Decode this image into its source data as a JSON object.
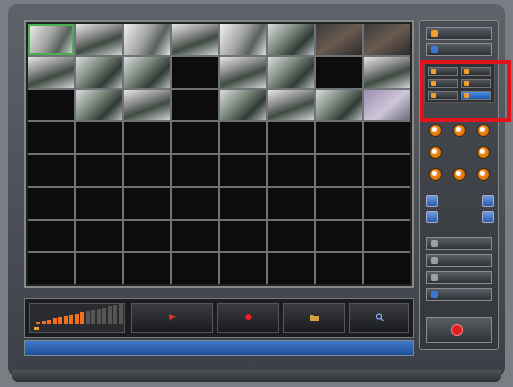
{
  "grid": {
    "cameras": [
      {
        "index": 0,
        "style": "v3",
        "selected": true,
        "timestamp": ""
      },
      {
        "index": 1,
        "style": "v2",
        "timestamp": ""
      },
      {
        "index": 2,
        "style": "v3",
        "timestamp": ""
      },
      {
        "index": 3,
        "style": "v2",
        "timestamp": ""
      },
      {
        "index": 4,
        "style": "v3",
        "timestamp": ""
      },
      {
        "index": 5,
        "style": "",
        "timestamp": ""
      },
      {
        "index": 6,
        "style": "v4",
        "timestamp": ""
      },
      {
        "index": 7,
        "style": "v4",
        "timestamp": ""
      },
      {
        "index": 8,
        "style": "v2",
        "timestamp": ""
      },
      {
        "index": 9,
        "style": "",
        "timestamp": ""
      },
      {
        "index": 10,
        "style": "",
        "timestamp": ""
      },
      {
        "index": 12,
        "style": "v2",
        "timestamp": ""
      },
      {
        "index": 13,
        "style": "",
        "timestamp": ""
      },
      {
        "index": 15,
        "style": "v2",
        "timestamp": ""
      },
      {
        "index": 17,
        "style": "",
        "timestamp": ""
      },
      {
        "index": 18,
        "style": "v2",
        "timestamp": ""
      },
      {
        "index": 20,
        "style": "",
        "timestamp": ""
      },
      {
        "index": 21,
        "style": "v2",
        "timestamp": ""
      },
      {
        "index": 22,
        "style": "",
        "timestamp": ""
      },
      {
        "index": 23,
        "style": "v5",
        "timestamp": ""
      }
    ],
    "columns": 8,
    "rows": 8
  },
  "right_panel": {
    "top_buttons": [
      {
        "label": "",
        "icon": "orange-square-icon",
        "color": "#f0a030"
      },
      {
        "label": "",
        "icon": "blue-arrow-icon",
        "color": "#3a78d8"
      }
    ],
    "split_buttons": [
      {
        "label": "",
        "active": false
      },
      {
        "label": "",
        "active": false
      },
      {
        "label": "",
        "active": false
      },
      {
        "label": "",
        "active": false
      },
      {
        "label": "",
        "active": false
      },
      {
        "label": "",
        "active": true
      }
    ],
    "ptz_center_label": "",
    "zoom_rows": [
      {
        "label": ""
      },
      {
        "label": ""
      }
    ],
    "menu_buttons": [
      {
        "label": "",
        "icon": "gear-icon"
      },
      {
        "label": "",
        "icon": "gear-icon"
      },
      {
        "label": "",
        "icon": "gear-icon"
      },
      {
        "label": "",
        "icon": "blue-arrow-icon"
      }
    ],
    "exit_label": ""
  },
  "toolbar": {
    "volume_label": "",
    "volume_level": 0.55,
    "buttons": [
      {
        "label": "",
        "icon": "pointer-icon"
      },
      {
        "label": "",
        "icon": "record-icon"
      },
      {
        "label": "",
        "icon": "folder-icon"
      },
      {
        "label": "",
        "icon": "search-icon"
      }
    ]
  },
  "status": {
    "text": ""
  },
  "colors": {
    "accent_orange": "#f0a030",
    "accent_blue": "#3a78d8",
    "highlight_red": "#e0141a"
  }
}
